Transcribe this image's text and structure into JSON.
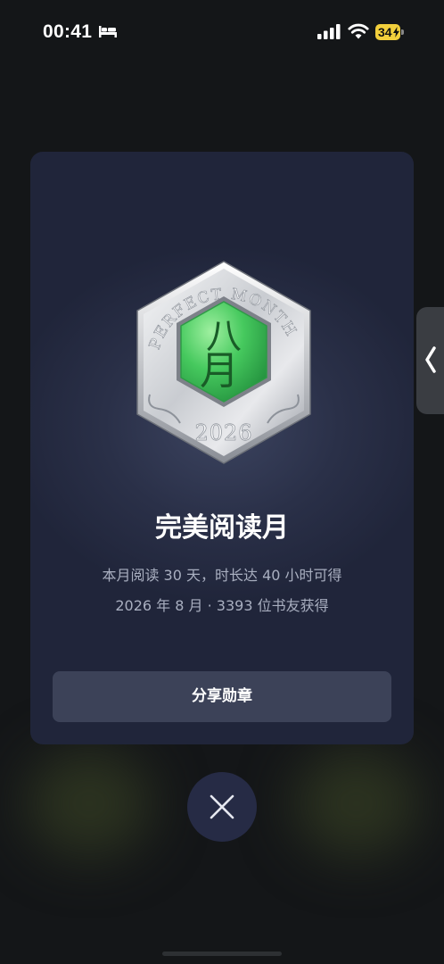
{
  "status_bar": {
    "time": "00:41",
    "battery_level": "34",
    "icons": [
      "bed-icon",
      "signal-icon",
      "wifi-icon",
      "battery-charging-icon"
    ]
  },
  "badge": {
    "arc_text": "PERFECT MONTH",
    "glyph_top": "八",
    "glyph_bottom": "月",
    "year": "2026",
    "colors": {
      "silver": "#d9dbdf",
      "green": "#3cc15c",
      "glyph": "#1a5a26"
    }
  },
  "title": "完美阅读月",
  "description": {
    "line1": "本月阅读 30 天，时长达 40 小时可得",
    "line2": "2026 年 8 月 · 3393 位书友获得"
  },
  "share_button": {
    "label": "分享勋章"
  },
  "close_button": {
    "icon": "close-icon"
  },
  "side_handle": {
    "icon": "chevron-left-icon"
  },
  "colors": {
    "background": "#141618",
    "card": "#262c45",
    "button": "#3c4258",
    "muted_text": "#a9afc0",
    "battery": "#f2cf3c"
  }
}
